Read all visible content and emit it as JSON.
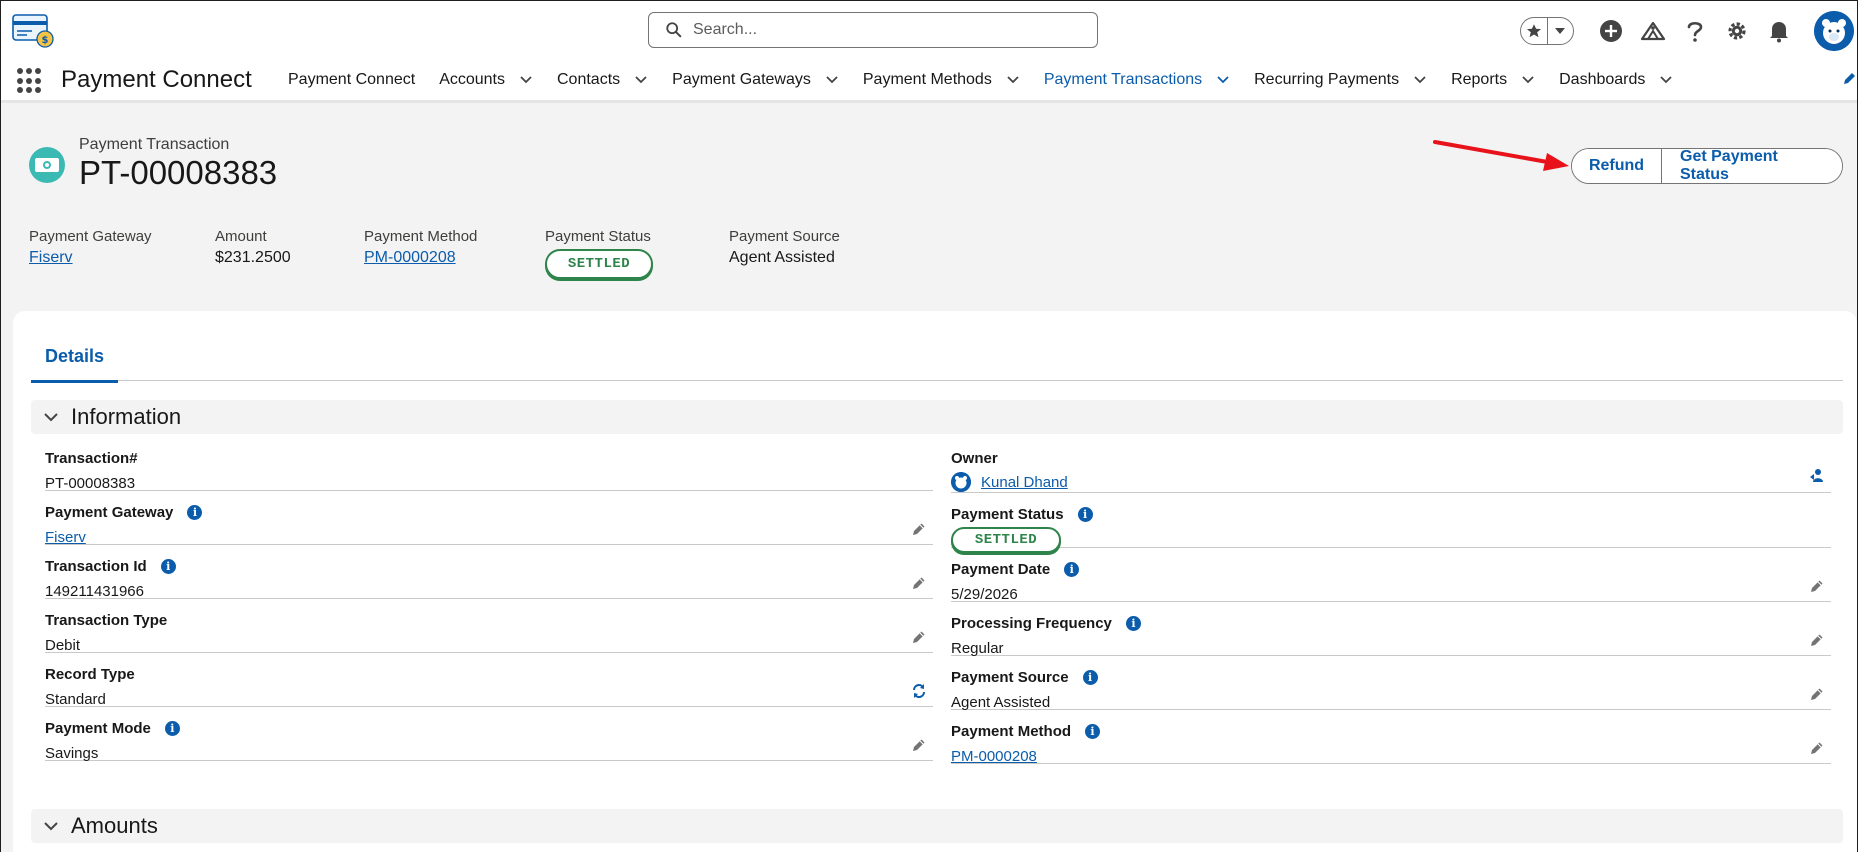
{
  "header": {
    "search_placeholder": "Search...",
    "icons": [
      "favorites-star-icon",
      "favorites-dropdown-icon",
      "add-icon",
      "trailhead-icon",
      "help-icon",
      "setup-gear-icon",
      "notifications-bell-icon",
      "user-avatar"
    ]
  },
  "nav": {
    "app_name": "Payment Connect",
    "items": [
      {
        "label": "Payment Connect",
        "has_menu": false
      },
      {
        "label": "Accounts",
        "has_menu": true
      },
      {
        "label": "Contacts",
        "has_menu": true
      },
      {
        "label": "Payment Gateways",
        "has_menu": true
      },
      {
        "label": "Payment Methods",
        "has_menu": true
      },
      {
        "label": "Payment Transactions",
        "has_menu": true,
        "active": true
      },
      {
        "label": "Recurring Payments",
        "has_menu": true
      },
      {
        "label": "Reports",
        "has_menu": true
      },
      {
        "label": "Dashboards",
        "has_menu": true
      }
    ]
  },
  "record": {
    "object_label": "Payment Transaction",
    "name": "PT-00008383",
    "actions": {
      "refund": "Refund",
      "get_status": "Get Payment Status"
    },
    "highlights": [
      {
        "label": "Payment Gateway",
        "value": "Fiserv",
        "type": "link"
      },
      {
        "label": "Amount",
        "value": "$231.2500",
        "type": "text"
      },
      {
        "label": "Payment Method",
        "value": "PM-0000208",
        "type": "link"
      },
      {
        "label": "Payment Status",
        "value": "SETTLED",
        "type": "badge"
      },
      {
        "label": "Payment Source",
        "value": "Agent Assisted",
        "type": "text"
      }
    ]
  },
  "tabs": {
    "details": "Details"
  },
  "sections": {
    "information": "Information",
    "amounts": "Amounts"
  },
  "fields_left": [
    {
      "label": "Transaction#",
      "value": "PT-00008383",
      "info": false,
      "action": "none",
      "type": "text"
    },
    {
      "label": "Payment Gateway",
      "value": "Fiserv",
      "info": true,
      "action": "edit",
      "type": "link"
    },
    {
      "label": "Transaction Id",
      "value": "149211431966",
      "info": true,
      "action": "edit",
      "type": "text"
    },
    {
      "label": "Transaction Type",
      "value": "Debit",
      "info": false,
      "action": "edit",
      "type": "text"
    },
    {
      "label": "Record Type",
      "value": "Standard",
      "info": false,
      "action": "change",
      "type": "text"
    },
    {
      "label": "Payment Mode",
      "value": "Savings",
      "info": true,
      "action": "edit",
      "type": "text"
    }
  ],
  "fields_right": [
    {
      "label": "Owner",
      "value": "Kunal Dhand",
      "info": false,
      "action": "change-owner",
      "type": "owner"
    },
    {
      "label": "Payment Status",
      "value": "SETTLED",
      "info": true,
      "action": "none",
      "type": "badge"
    },
    {
      "label": "Payment Date",
      "value": "5/29/2026",
      "info": true,
      "action": "edit",
      "type": "text"
    },
    {
      "label": "Processing Frequency",
      "value": "Regular",
      "info": true,
      "action": "edit",
      "type": "text"
    },
    {
      "label": "Payment Source",
      "value": "Agent Assisted",
      "info": true,
      "action": "edit",
      "type": "text"
    },
    {
      "label": "Payment Method",
      "value": "PM-0000208",
      "info": true,
      "action": "edit",
      "type": "link"
    }
  ],
  "colors": {
    "brand": "#0b5cab",
    "success": "#2e844a",
    "record_icon": "#3bb9b3",
    "annotation": "#e8131a"
  }
}
